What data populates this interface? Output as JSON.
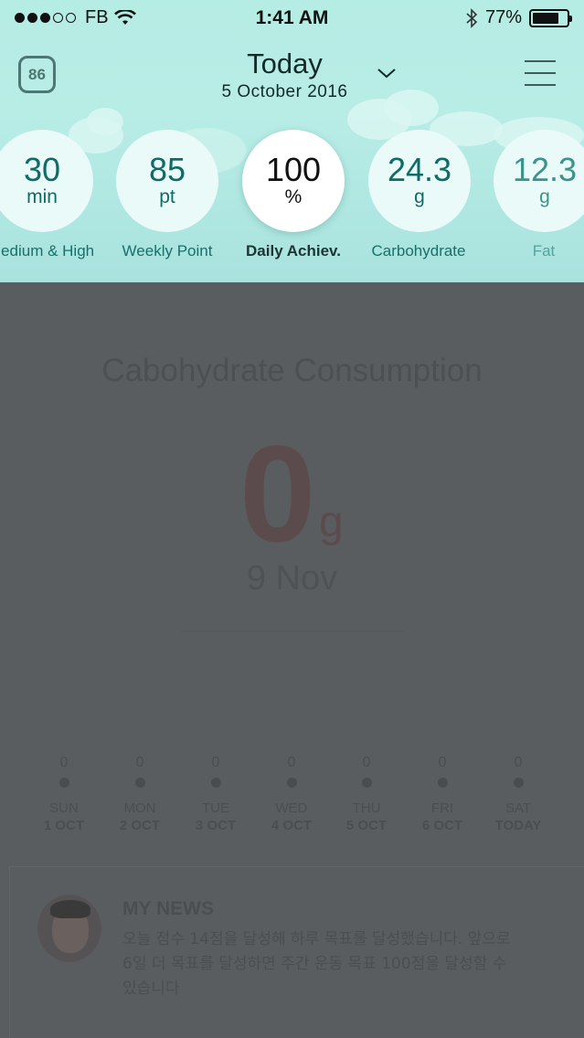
{
  "status_bar": {
    "carrier": "FB",
    "time": "1:41 AM",
    "battery": "77%",
    "battery_level": 0.77,
    "signal_icon": "signal-dots-icon",
    "wifi_icon": "wifi-icon",
    "bluetooth_icon": "bluetooth-icon"
  },
  "header": {
    "score": "86",
    "title": "Today",
    "date": "5 October 2016",
    "dropdown_icon": "chevron-down-icon",
    "menu_icon": "hamburger-menu-icon"
  },
  "stats": [
    {
      "value": "30",
      "unit": "min",
      "label": "Medium & High"
    },
    {
      "value": "85",
      "unit": "pt",
      "label": "Weekly Point"
    },
    {
      "value": "100",
      "unit": "%",
      "label": "Daily Achiev."
    },
    {
      "value": "24.3",
      "unit": "g",
      "label": "Carbohydrate"
    },
    {
      "value": "12.3",
      "unit": "g",
      "label": "Fat"
    }
  ],
  "main": {
    "title": "Cabohydrate Consumption",
    "value": "0",
    "unit": "g",
    "date": "9 Nov"
  },
  "week": [
    {
      "value": "0",
      "day": "SUN",
      "date": "1 OCT"
    },
    {
      "value": "0",
      "day": "MON",
      "date": "2 OCT"
    },
    {
      "value": "0",
      "day": "TUE",
      "date": "3 OCT"
    },
    {
      "value": "0",
      "day": "WED",
      "date": "4 OCT"
    },
    {
      "value": "0",
      "day": "THU",
      "date": "5 OCT"
    },
    {
      "value": "0",
      "day": "FRI",
      "date": "6 OCT"
    },
    {
      "value": "0",
      "day": "SAT",
      "date": "TODAY"
    }
  ],
  "news": {
    "title": "MY NEWS",
    "text": "오늘 점수 14점을 달성해 하루 목표를 달성했습니다. 앞으로 6일 더 목표를 달성하면 주간 운동 목표 100점을 달성할 수 있습니다"
  },
  "colors": {
    "header_bg": "#b5ece4",
    "accent": "#0f6b66",
    "overlay": "#5a5d60"
  }
}
